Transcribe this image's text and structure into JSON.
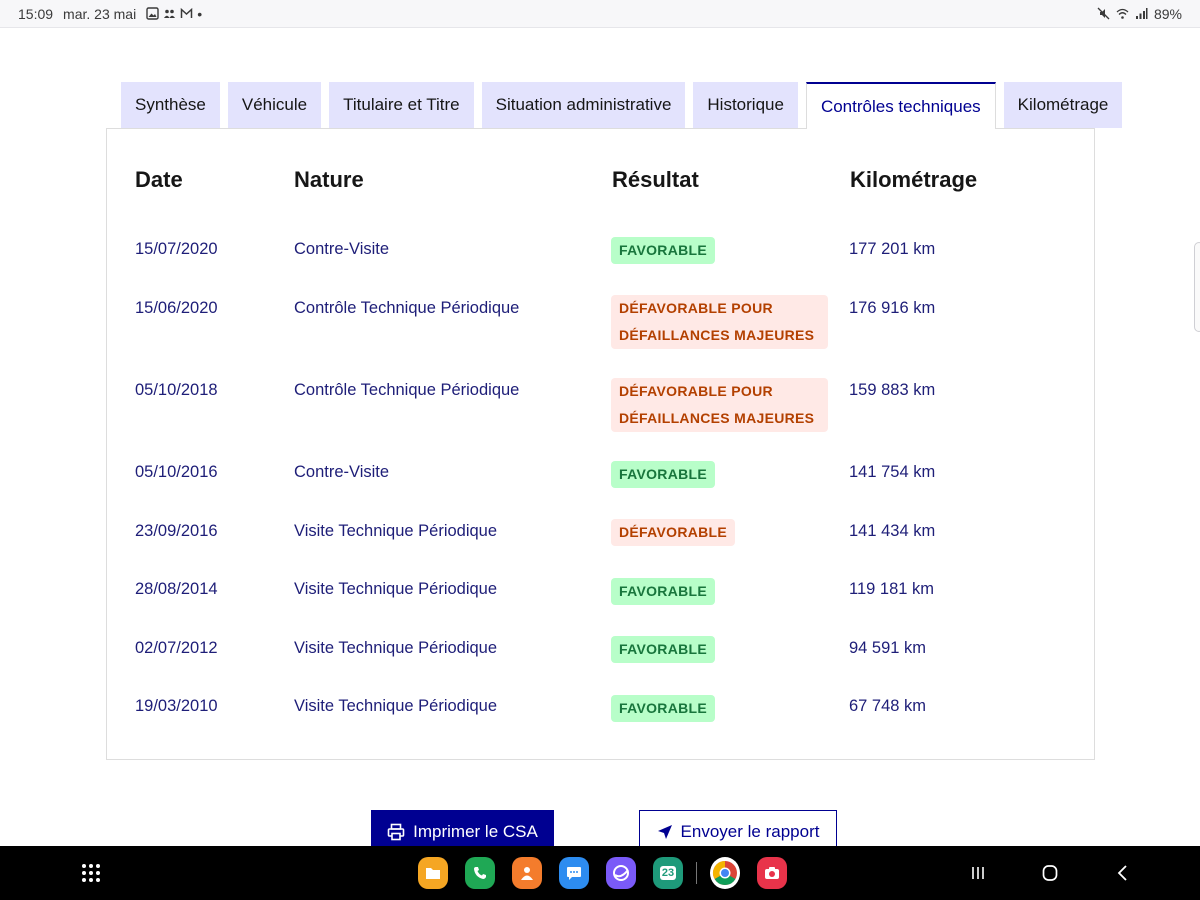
{
  "status_bar": {
    "time": "15:09",
    "date": "mar. 23 mai",
    "battery": "89%",
    "dot": "•"
  },
  "tabs": [
    {
      "label": "Synthèse",
      "active": false
    },
    {
      "label": "Véhicule",
      "active": false
    },
    {
      "label": "Titulaire et Titre",
      "active": false
    },
    {
      "label": "Situation administrative",
      "active": false
    },
    {
      "label": "Historique",
      "active": false
    },
    {
      "label": "Contrôles techniques",
      "active": true
    },
    {
      "label": "Kilométrage",
      "active": false
    }
  ],
  "table": {
    "headers": {
      "date": "Date",
      "nature": "Nature",
      "result": "Résultat",
      "km": "Kilométrage"
    },
    "rows": [
      {
        "date": "15/07/2020",
        "nature": "Contre-Visite",
        "result_lines": [
          "FAVORABLE"
        ],
        "status": "favorable",
        "km": "177 201 km"
      },
      {
        "date": "15/06/2020",
        "nature": "Contrôle Technique Périodique",
        "result_lines": [
          "DÉFAVORABLE POUR",
          "DÉFAILLANCES MAJEURES"
        ],
        "status": "defavorable",
        "km": "176 916 km"
      },
      {
        "date": "05/10/2018",
        "nature": "Contrôle Technique Périodique",
        "result_lines": [
          "DÉFAVORABLE POUR",
          "DÉFAILLANCES MAJEURES"
        ],
        "status": "defavorable",
        "km": "159 883 km"
      },
      {
        "date": "05/10/2016",
        "nature": "Contre-Visite",
        "result_lines": [
          "FAVORABLE"
        ],
        "status": "favorable",
        "km": "141 754 km"
      },
      {
        "date": "23/09/2016",
        "nature": "Visite Technique Périodique",
        "result_lines": [
          "DÉFAVORABLE"
        ],
        "status": "defavorable",
        "km": "141 434 km"
      },
      {
        "date": "28/08/2014",
        "nature": "Visite Technique Périodique",
        "result_lines": [
          "FAVORABLE"
        ],
        "status": "favorable",
        "km": "119 181 km"
      },
      {
        "date": "02/07/2012",
        "nature": "Visite Technique Périodique",
        "result_lines": [
          "FAVORABLE"
        ],
        "status": "favorable",
        "km": "94 591 km"
      },
      {
        "date": "19/03/2010",
        "nature": "Visite Technique Périodique",
        "result_lines": [
          "FAVORABLE"
        ],
        "status": "favorable",
        "km": "67 748 km"
      }
    ]
  },
  "buttons": {
    "print": {
      "label": "Imprimer le CSA",
      "icon": "printer-icon"
    },
    "send": {
      "label": "Envoyer le rapport",
      "icon": "send-arrow-icon"
    }
  },
  "nav_bar": {
    "calendar_day": "23",
    "apps": [
      {
        "name": "files-icon",
        "color": "#f5a623"
      },
      {
        "name": "phone-icon",
        "color": "#1fa855"
      },
      {
        "name": "contacts-icon",
        "color": "#f47c2c"
      },
      {
        "name": "messages-icon",
        "color": "#2d8cf0"
      },
      {
        "name": "internet-icon",
        "color": "#7a5af8"
      },
      {
        "name": "calendar-icon",
        "color": "#1e9a7a"
      },
      {
        "name": "chrome-icon",
        "color": "#ffffff"
      },
      {
        "name": "camera-icon",
        "color": "#e8334a"
      }
    ]
  },
  "colors": {
    "primary": "#000091",
    "favorable_bg": "#b8fec9",
    "favorable_text": "#18753c",
    "defavorable_bg": "#ffe9e6",
    "defavorable_text": "#b34000",
    "tab_bg": "#e3e3fd"
  }
}
